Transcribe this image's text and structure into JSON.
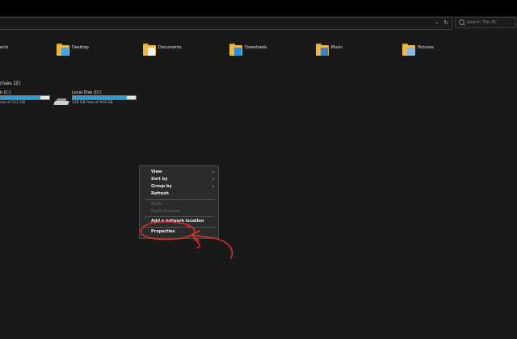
{
  "address_bar": {
    "dropdown_icon": "chevron-down-icon",
    "refresh_icon": "refresh-icon"
  },
  "search": {
    "placeholder": "Search This PC",
    "icon": "search-icon"
  },
  "folders": [
    {
      "label": "Desktop",
      "icon": "desktop-folder-icon",
      "badge_color": "#4aa3e0"
    },
    {
      "label": "Documents",
      "icon": "documents-folder-icon",
      "badge_color": "#f2f2f2"
    },
    {
      "label": "Downloads",
      "icon": "downloads-folder-icon",
      "badge_color": "#2b8fd6"
    },
    {
      "label": "Music",
      "icon": "music-folder-icon",
      "badge_color": "#3b7fd1"
    },
    {
      "label": "Pictures",
      "icon": "pictures-folder-icon",
      "badge_color": "#86b9e6"
    }
  ],
  "folders_partial_label": "ects",
  "drives_header": "rives (2)",
  "drives": [
    {
      "label": "k (C:)",
      "free": "ree of 111 GB",
      "used_fraction": 0.82
    },
    {
      "label": "Local Disk (D:)",
      "free": "130 GB free of 903 GB",
      "used_fraction": 0.86
    }
  ],
  "context_menu": {
    "items": [
      {
        "label": "View",
        "submenu": true,
        "disabled": false
      },
      {
        "label": "Sort by",
        "submenu": true,
        "disabled": false
      },
      {
        "label": "Group by",
        "submenu": true,
        "disabled": false
      },
      {
        "label": "Refresh",
        "submenu": false,
        "disabled": false
      },
      {
        "label": "Paste",
        "submenu": false,
        "disabled": true
      },
      {
        "label": "Paste shortcut",
        "submenu": false,
        "disabled": true
      },
      {
        "label": "Add a network location",
        "submenu": false,
        "disabled": false
      },
      {
        "label": "Properties",
        "submenu": false,
        "disabled": false
      }
    ],
    "submenu_arrow_glyph": "›"
  },
  "colors": {
    "background": "#191919",
    "menu_background": "#2b2b2b",
    "drive_bar_fill": "#26a0da",
    "annotation": "#d9302a",
    "folder": "#e8b84b"
  }
}
